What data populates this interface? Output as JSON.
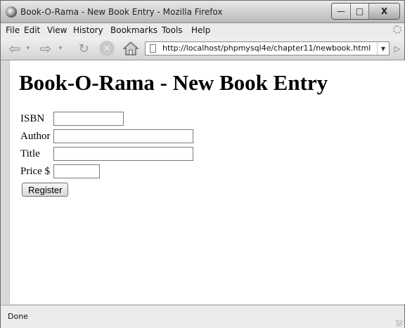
{
  "window": {
    "title": "Book-O-Rama - New Book Entry - Mozilla Firefox"
  },
  "controls": {
    "minimize": "—",
    "maximize": "□",
    "close": "X"
  },
  "menu": [
    "File",
    "Edit",
    "View",
    "History",
    "Bookmarks",
    "Tools",
    "Help"
  ],
  "nav": {
    "url": "http://localhost/phpmysql4e/chapter11/newbook.html"
  },
  "page": {
    "heading": "Book-O-Rama - New Book Entry",
    "fields": [
      {
        "label": "ISBN",
        "value": ""
      },
      {
        "label": "Author",
        "value": ""
      },
      {
        "label": "Title",
        "value": ""
      },
      {
        "label": "Price $",
        "value": ""
      }
    ],
    "submit_label": "Register"
  },
  "status": {
    "text": "Done"
  },
  "icons": [
    "app-icon",
    "back-icon",
    "forward-icon",
    "reload-icon",
    "stop-icon",
    "home-icon",
    "page-icon",
    "go-icon",
    "throbber-icon"
  ]
}
